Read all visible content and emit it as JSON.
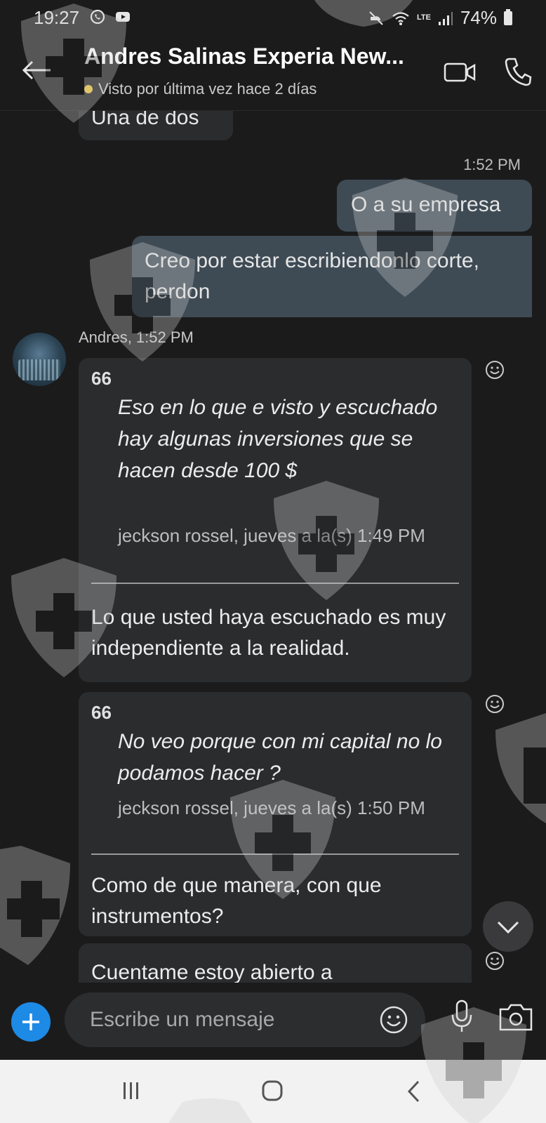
{
  "status_bar": {
    "time": "19:27",
    "battery": "74%",
    "network": "LTE"
  },
  "header": {
    "title": "Andres Salinas Experia New...",
    "status": "Visto por última vez hace 2 días"
  },
  "messages": {
    "partial_prev": "Una de dos",
    "outgoing_time": "1:52 PM",
    "outgoing": [
      "O a su empresa",
      "Creo por estar escribiendonlo corte, perdon"
    ],
    "incoming_sender": "Andres, 1:52 PM",
    "quote_mark": "66",
    "cards": [
      {
        "quote": "Eso en lo que e visto y escuchado hay algunas inversiones que se hacen desde 100 $",
        "meta": "jeckson rossel, jueves a la(s) 1:49 PM",
        "reply": "Lo que usted haya escuchado es muy independiente a la realidad."
      },
      {
        "quote": "No veo porque con mi capital no lo podamos hacer ?",
        "meta": "jeckson rossel, jueves a la(s) 1:50 PM",
        "reply": "Como de que manera, con que instrumentos?"
      }
    ],
    "partial_next": "Cuentame estoy abierto a"
  },
  "compose": {
    "placeholder": "Escribe un mensaje"
  },
  "colors": {
    "accent": "#1d8ae5",
    "background": "#1b1b1c",
    "incoming_bubble": "#2b2c2e",
    "outgoing_bubble": "#3e4b55",
    "presence": "#e8c23a"
  },
  "icons": [
    "back-arrow-icon",
    "video-call-icon",
    "phone-icon",
    "emoji-icon",
    "microphone-icon",
    "camera-icon",
    "plus-icon",
    "chevron-down-icon"
  ]
}
